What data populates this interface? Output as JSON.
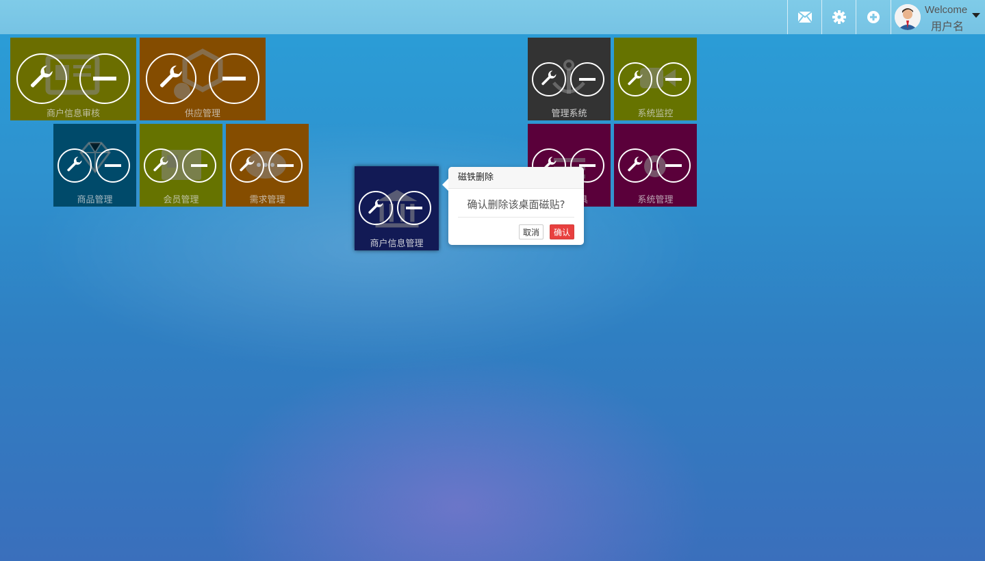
{
  "topbar": {
    "icons": [
      "mail-icon",
      "gear-icon",
      "plus-circle-icon"
    ],
    "user": {
      "welcome": "Welcome",
      "name": "用户名"
    }
  },
  "tiles": [
    {
      "id": "merchant-review",
      "label": "商户信息审核",
      "color": "#6b6e00",
      "icon": "newspaper-icon"
    },
    {
      "id": "supply",
      "label": "供应管理",
      "color": "#844c00",
      "icon": "cubes-icon"
    },
    {
      "id": "goods",
      "label": "商品管理",
      "color": "#004a6a",
      "icon": "diamond-icon"
    },
    {
      "id": "member",
      "label": "会员管理",
      "color": "#667300",
      "icon": "id-card-icon"
    },
    {
      "id": "demand",
      "label": "需求管理",
      "color": "#854d00",
      "icon": "comments-icon"
    },
    {
      "id": "merchant-info",
      "label": "商户信息管理",
      "color": "#121a55",
      "icon": "bank-icon"
    },
    {
      "id": "admin-system",
      "label": "管理系统",
      "color": "#333333",
      "icon": "anchor-icon"
    },
    {
      "id": "monitor",
      "label": "系统监控",
      "color": "#667300",
      "icon": "video-camera-icon"
    },
    {
      "id": "tools",
      "label": "具",
      "color": "#5a003a",
      "icon": "list-icon"
    },
    {
      "id": "sys-manage",
      "label": "系统管理",
      "color": "#5a003a",
      "icon": "cog-icon"
    }
  ],
  "popover": {
    "title": "磁铁删除",
    "message": "确认删除该桌面磁贴?",
    "cancel": "取消",
    "confirm": "确认"
  },
  "colors": {
    "confirm": "#e8403f",
    "topbar": "#7cc9e7"
  }
}
